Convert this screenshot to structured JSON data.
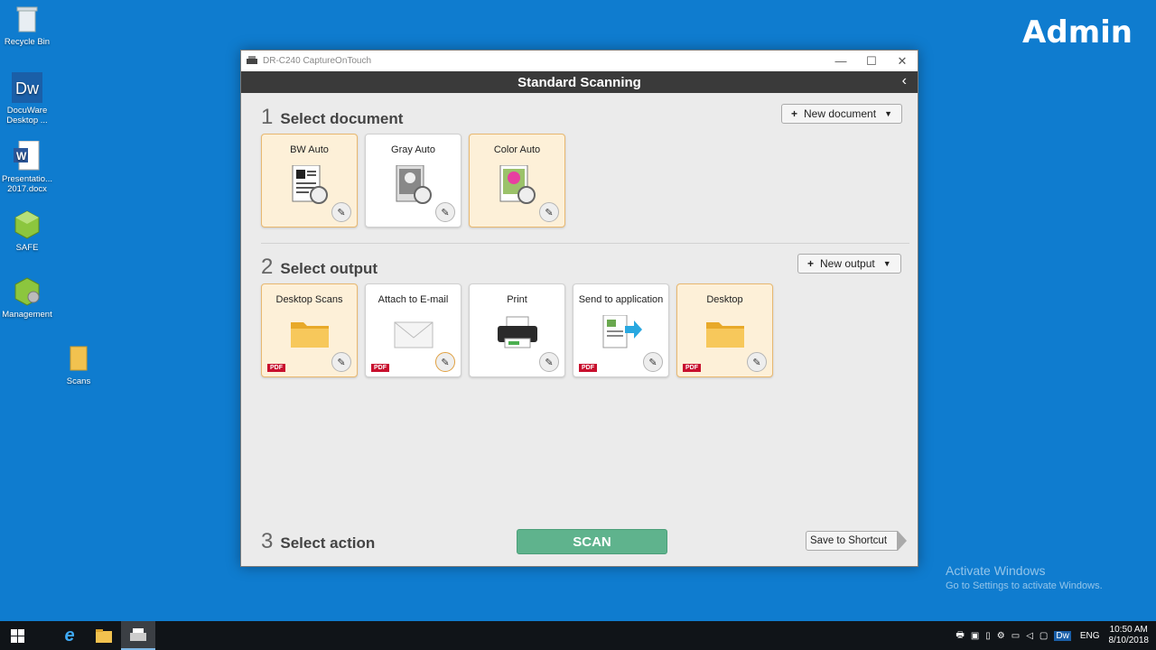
{
  "desktop": {
    "user": "Admin",
    "icons": [
      {
        "label": "Recycle Bin"
      },
      {
        "label": "DocuWare Desktop ..."
      },
      {
        "label": "Presentatio... 2017.docx"
      },
      {
        "label": "SAFE"
      },
      {
        "label": "Management"
      },
      {
        "label": "Scans"
      }
    ],
    "activate_title": "Activate Windows",
    "activate_sub": "Go to Settings to activate Windows."
  },
  "window": {
    "title": "DR-C240 CaptureOnTouch",
    "header": "Standard Scanning",
    "section1": {
      "number": "1",
      "label": "Select document",
      "button": "New document",
      "cards": [
        {
          "label": "BW Auto",
          "icon": "bw-doc-icon"
        },
        {
          "label": "Gray Auto",
          "icon": "gray-doc-icon"
        },
        {
          "label": "Color Auto",
          "icon": "color-doc-icon"
        }
      ]
    },
    "section2": {
      "number": "2",
      "label": "Select output",
      "button": "New output",
      "cards": [
        {
          "label": "Desktop Scans",
          "icon": "folder-icon",
          "badge": "PDF"
        },
        {
          "label": "Attach to E-mail",
          "icon": "envelope-icon",
          "badge": "PDF"
        },
        {
          "label": "Print",
          "icon": "printer-icon"
        },
        {
          "label": "Send to application",
          "icon": "send-app-icon",
          "badge": "PDF"
        },
        {
          "label": "Desktop",
          "icon": "folder-icon",
          "badge": "PDF"
        }
      ]
    },
    "section3": {
      "number": "3",
      "label": "Select action",
      "scan_button": "SCAN",
      "shortcut_button": "Save to Shortcut"
    }
  },
  "taskbar": {
    "lang": "ENG",
    "time": "10:50 AM",
    "date": "8/10/2018"
  },
  "colors": {
    "desktop": "#0f7ccf",
    "scan_button": "#5fb38d",
    "selected_card": "#fdf0d8",
    "pdf_badge": "#c8102e"
  }
}
